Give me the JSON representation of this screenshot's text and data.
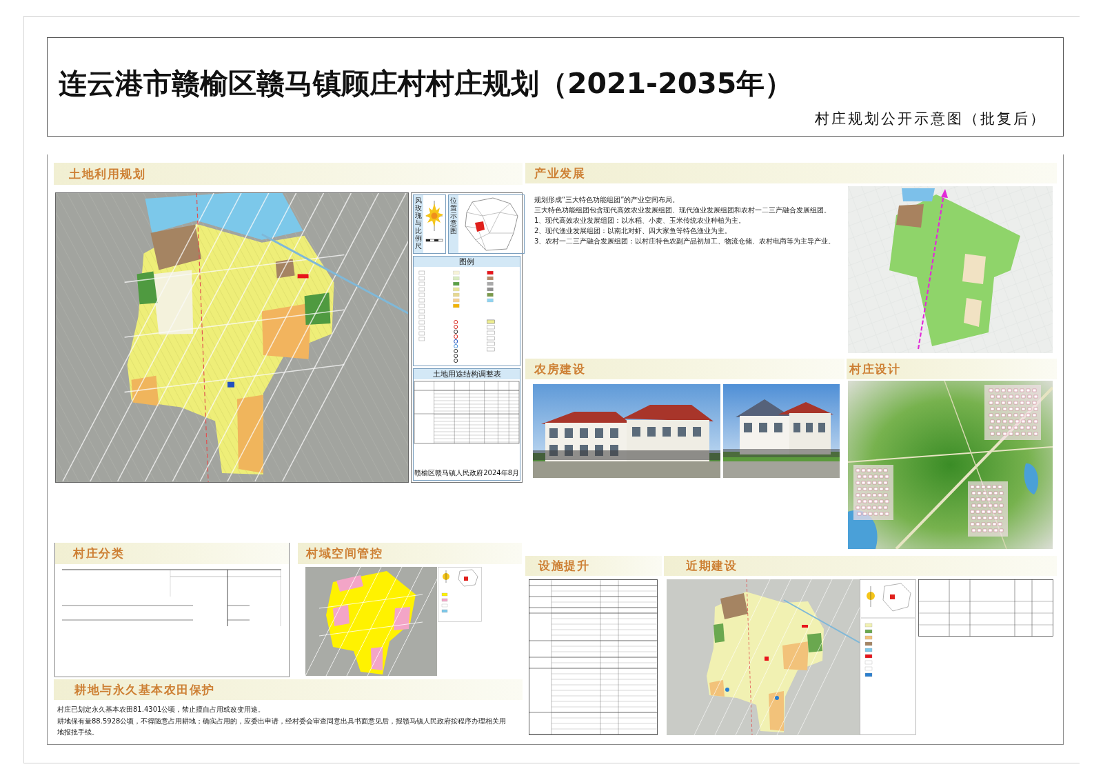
{
  "poster": {
    "title": "连云港市赣榆区赣马镇顾庄村村庄规划（2021-2035年）",
    "subtitle": "村庄规划公开示意图（批复后）"
  },
  "land_use_planning": {
    "heading": "土地利用规划",
    "map_sheet": {
      "wind_rose_label": "风玫瑰与比例尺",
      "location_label": "位置示意图",
      "legend_title": "图例",
      "table_title": "土地用途结构调整表",
      "issuer": "赣榆区赣马镇人民政府",
      "date": "2024年8月"
    }
  },
  "village_classification": {
    "heading": "村庄分类"
  },
  "spatial_control": {
    "heading": "村域空间管控"
  },
  "farmland_protection": {
    "heading": "耕地与永久基本农田保护",
    "paragraphs": [
      "村庄已划定永久基本农田81.4301公顷，禁止擅自占用或改变用途。",
      "耕地保有量88.5928公顷，不得随意占用耕地；确实占用的，应委出申请，经村委会审查同意出具书面意见后，报赣马镇人民政府按程序办理相关用地报批手续。"
    ]
  },
  "industry": {
    "heading": "产业发展",
    "paragraphs": [
      "规划形成“三大特色功能组团”的产业空间布局。",
      "三大特色功能组团包含现代高效农业发展组团、现代渔业发展组团和农村一二三产融合发展组团。",
      "1、现代高效农业发展组团：以水稻、小麦、玉米传统农业种植为主。",
      "2、现代渔业发展组团：以南北对虾、四大家鱼等特色渔业为主。",
      "3、农村一二三产融合发展组团：以村庄特色农副产品初加工、物流仓储、农村电商等为主导产业。"
    ]
  },
  "housing": {
    "heading": "农房建设"
  },
  "village_design": {
    "heading": "村庄设计"
  },
  "facilities": {
    "heading": "设施提升"
  },
  "near_term": {
    "heading": "近期建设"
  }
}
